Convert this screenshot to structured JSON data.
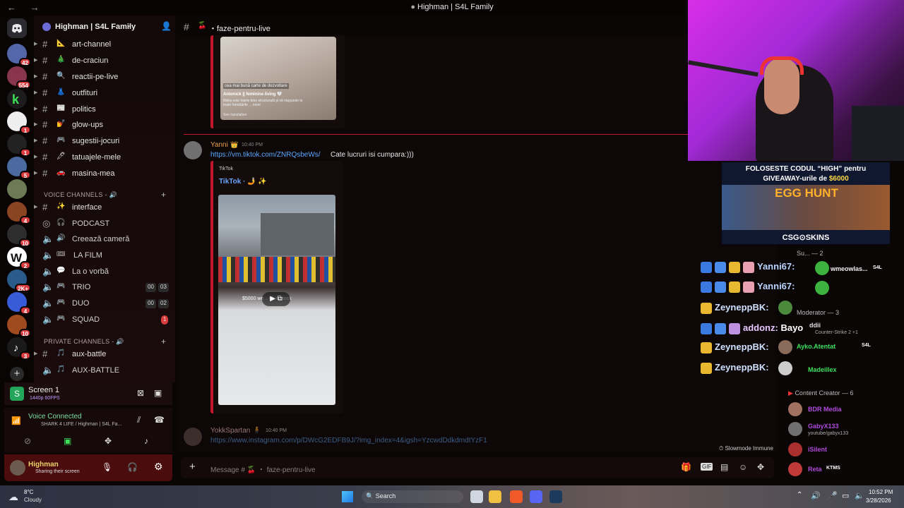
{
  "window": {
    "title": "Highman | S4L Family",
    "nav": "← →"
  },
  "server": {
    "name": "Highman | S4L Family",
    "chevron": "⌄"
  },
  "rail_badges": [
    "42",
    "554",
    "1",
    "1",
    "1",
    "5",
    "4",
    "10",
    "2",
    "2K+",
    "4",
    "10",
    "3"
  ],
  "channels": [
    {
      "emoji": "📐",
      "name": "art-channel"
    },
    {
      "emoji": "🎄",
      "name": "de-craciun"
    },
    {
      "emoji": "🔍",
      "name": "reactii-pe-live"
    },
    {
      "emoji": "👗",
      "name": "outfituri"
    },
    {
      "emoji": "📰",
      "name": "politics"
    },
    {
      "emoji": "💅",
      "name": "glow-ups"
    },
    {
      "emoji": "🎮",
      "name": "sugestii-jocuri"
    },
    {
      "emoji": "🖊",
      "name": "tatuajele-mele"
    },
    {
      "emoji": "🚗",
      "name": "masina-mea"
    }
  ],
  "voice_category": "VOICE CHANNELS - 🔊",
  "voice_channels": [
    {
      "emoji": "✨",
      "name": "interface",
      "type": "text"
    },
    {
      "emoji": "🎧",
      "name": "PODCAST"
    },
    {
      "emoji": "🔊",
      "name": "Creează cameră"
    },
    {
      "emoji": "🎟",
      "name": "LA FILM"
    },
    {
      "emoji": "💬",
      "name": "La o vorbă"
    },
    {
      "emoji": "🎮",
      "name": "TRIO",
      "left": "00",
      "right": "03"
    },
    {
      "emoji": "🎮",
      "name": "DUO",
      "left": "00",
      "right": "02"
    },
    {
      "emoji": "🎮",
      "name": "SQUAD",
      "badge": "1"
    }
  ],
  "private_category": "PRIVATE CHANNELS - 🔊",
  "private_channels": [
    {
      "emoji": "🎵",
      "name": "aux-battle"
    },
    {
      "emoji": "🎵",
      "name": "AUX-BATTLE"
    }
  ],
  "screen_share": {
    "title": "Screen 1",
    "quality": "1440p 60FPS"
  },
  "voice": {
    "status": "Voice Connected",
    "location": "SHARK 4 LIFE / Highman | S4L Fa..."
  },
  "user": {
    "name": "Highman",
    "status": "Sharing their screen"
  },
  "chat_header": {
    "channel": "faze-pentru-live"
  },
  "top_embed": {
    "caption": "cea mai bună carte de dezvoltare",
    "author": "Antonick || feminine living 🤍",
    "body": "Biblia este foarte bine structurată și vă răspunde la toate întrebările ... more",
    "see": "See translation"
  },
  "message1": {
    "author": "Yanni",
    "time": "10:40 PM",
    "link": "https://vm.tiktok.com/ZNRQsbeWs/",
    "text": "Cate lucruri isi cumpara:)))",
    "provider": "TikTok",
    "embed_title": "TikTok · 🤳 ✨",
    "video_caption": "$5000 we... ck restock"
  },
  "message2": {
    "author": "YokkSpartan",
    "time": "10:40 PM",
    "link": "https://www.instagram.com/p/DWcG2EDFB9J/?img_index=4&igsh=YzcwdDdkdmdtYzF1"
  },
  "slowmode": "Slowmode Immune",
  "composer": {
    "placeholder": "Message # 🍒 ・ faze-pentru-live"
  },
  "ad": {
    "line1": "FOLOSESTE CODUL “HIGH” pentru",
    "line2a": "GIVEAWAY-urile de",
    "line2b": "$6000",
    "event": "EGG HUNT",
    "brand": "CSG⊙SKINS"
  },
  "members": {
    "support": "Su... — 2",
    "moderator": "Moderator — 3",
    "content": "Content Creator — 6",
    "m_names": [
      "wmeowlas...",
      "Yanni67",
      "ddii",
      "Ayko.Atentat",
      "Madeillex",
      "BDR Media",
      "GabyX133",
      "iSilent",
      "Reta"
    ],
    "m_sub": [
      "Counter-Strike 2 +1",
      "youtube/gabyx133"
    ],
    "tags": [
      "S4L",
      "S4L",
      "KTMS"
    ]
  },
  "overlay_chat": [
    {
      "name": "Yanni67:",
      "color": "#b8d4ff"
    },
    {
      "name": "Yanni67:",
      "color": "#b8d4ff"
    },
    {
      "name": "ZeyneppBK:",
      "color": "#cfe0ff"
    },
    {
      "name": "addonz:",
      "color": "#e8c8ff",
      "msg": "Bayo"
    },
    {
      "name": "ZeyneppBK:",
      "color": "#cfe0ff"
    },
    {
      "name": "ZeyneppBK:",
      "color": "#cfe0ff"
    }
  ],
  "taskbar": {
    "temp": "8°C",
    "weather": "Cloudy",
    "search": "Search",
    "time": "10:52 PM",
    "date": "3/28/2026"
  }
}
